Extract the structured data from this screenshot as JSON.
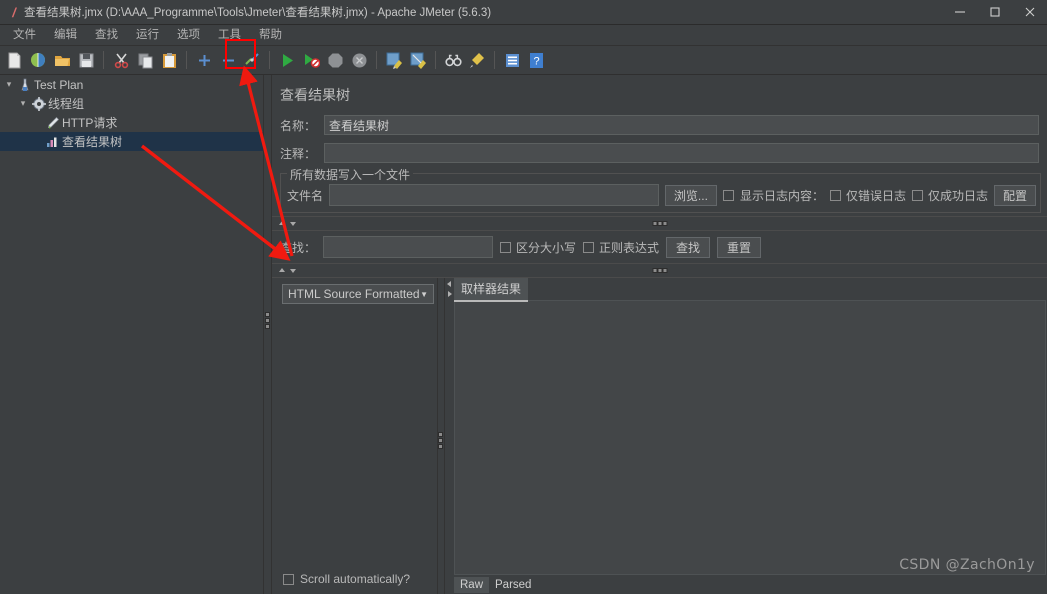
{
  "window": {
    "title": "查看结果树.jmx (D:\\AAA_Programme\\Tools\\Jmeter\\查看结果树.jmx) - Apache JMeter (5.6.3)",
    "app_icon": "jmeter-feather-icon",
    "minimize": "−",
    "maximize": "▢",
    "close": "✕"
  },
  "menubar": {
    "items": [
      {
        "label": "文件",
        "name": "menu-file"
      },
      {
        "label": "编辑",
        "name": "menu-edit"
      },
      {
        "label": "查找",
        "name": "menu-search"
      },
      {
        "label": "运行",
        "name": "menu-run"
      },
      {
        "label": "选项",
        "name": "menu-options"
      },
      {
        "label": "工具",
        "name": "menu-tools"
      },
      {
        "label": "帮助",
        "name": "menu-help"
      }
    ]
  },
  "toolbar": {
    "items": [
      {
        "icon": "new-document-icon",
        "name": "toolbar-new"
      },
      {
        "icon": "templates-icon",
        "name": "toolbar-templates"
      },
      {
        "icon": "open-folder-icon",
        "name": "toolbar-open"
      },
      {
        "icon": "save-disk-icon",
        "name": "toolbar-save"
      },
      {
        "icon": "separator",
        "name": "toolbar-separator-1"
      },
      {
        "icon": "scissors-cut-icon",
        "name": "toolbar-cut"
      },
      {
        "icon": "copy-icon",
        "name": "toolbar-copy"
      },
      {
        "icon": "paste-clipboard-icon",
        "name": "toolbar-paste"
      },
      {
        "icon": "separator",
        "name": "toolbar-separator-2"
      },
      {
        "icon": "plus-expand-icon",
        "name": "toolbar-expand-all"
      },
      {
        "icon": "minus-collapse-icon",
        "name": "toolbar-collapse-all"
      },
      {
        "icon": "toggle-enable-icon",
        "name": "toolbar-toggle"
      },
      {
        "icon": "separator",
        "name": "toolbar-separator-3"
      },
      {
        "icon": "green-play-start-icon",
        "name": "toolbar-start",
        "highlighted": true
      },
      {
        "icon": "play-no-timers-icon",
        "name": "toolbar-start-no-pauses"
      },
      {
        "icon": "stop-octagon-icon",
        "name": "toolbar-stop"
      },
      {
        "icon": "shutdown-circle-icon",
        "name": "toolbar-shutdown"
      },
      {
        "icon": "separator",
        "name": "toolbar-separator-4"
      },
      {
        "icon": "clear-broom-icon",
        "name": "toolbar-clear"
      },
      {
        "icon": "clear-all-broom-icon",
        "name": "toolbar-clear-all"
      },
      {
        "icon": "separator",
        "name": "toolbar-separator-5"
      },
      {
        "icon": "binoculars-search-icon",
        "name": "toolbar-search"
      },
      {
        "icon": "reset-search-broom-icon",
        "name": "toolbar-search-reset"
      },
      {
        "icon": "separator",
        "name": "toolbar-separator-6"
      },
      {
        "icon": "function-helper-icon",
        "name": "toolbar-function-helper"
      },
      {
        "icon": "help-question-icon",
        "name": "toolbar-help"
      }
    ]
  },
  "tree": {
    "nodes": [
      {
        "label": "Test Plan",
        "icon": "test-plan-icon",
        "toggle": "▾",
        "indent": 0,
        "selected": false
      },
      {
        "label": "线程组",
        "icon": "thread-group-gear-icon",
        "toggle": "▾",
        "indent": 1,
        "selected": false
      },
      {
        "label": "HTTP请求",
        "icon": "http-request-icon",
        "toggle": "",
        "indent": 2,
        "selected": false
      },
      {
        "label": "查看结果树",
        "icon": "view-results-tree-icon",
        "toggle": "",
        "indent": 2,
        "selected": true
      }
    ]
  },
  "panel": {
    "title": "查看结果树",
    "name_label": "名称：",
    "name_value": "查看结果树",
    "comment_label": "注释：",
    "comment_value": "",
    "file_group_legend": "所有数据写入一个文件",
    "filename_label": "文件名",
    "filename_value": "",
    "browse_button": "浏览...",
    "log_display_label": "显示日志内容：",
    "errors_only_label": "仅错误日志",
    "errors_only_checked": false,
    "success_only_label": "仅成功日志",
    "success_only_checked": false,
    "configure_button": "配置",
    "write_checkbox_checked": false
  },
  "search": {
    "label": "查找：",
    "value": "",
    "case_sensitive_label": "区分大小写",
    "case_sensitive_checked": false,
    "regex_label": "正则表达式",
    "regex_checked": false,
    "find_button": "查找",
    "reset_button": "重置"
  },
  "renderer": {
    "selected": "HTML Source Formatted",
    "caret": "▼",
    "scroll_label": "Scroll automatically?",
    "scroll_checked": false
  },
  "results": {
    "tabs": [
      {
        "label": "取样器结果",
        "active": true
      }
    ],
    "bottom_tabs": [
      {
        "label": "Raw",
        "active": true
      },
      {
        "label": "Parsed",
        "active": false
      }
    ]
  },
  "annotations": {
    "watermark": "CSDN @ZachOn1y",
    "highlight_color": "#ff0000",
    "arrow_color": "#f01a10"
  }
}
